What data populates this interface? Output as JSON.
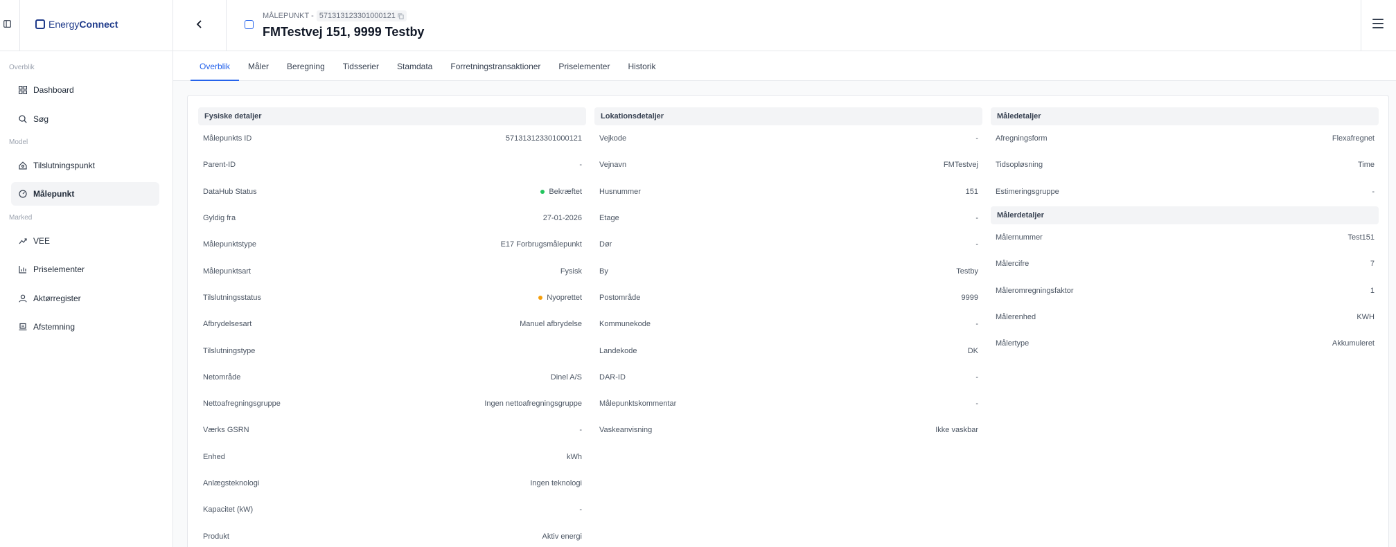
{
  "brand": {
    "name_part1": "Energy",
    "name_part2": "Connect"
  },
  "sidebar": {
    "sections": [
      {
        "label": "Overblik",
        "items": [
          {
            "label": "Dashboard",
            "icon": "grid-icon"
          },
          {
            "label": "Søg",
            "icon": "search-icon"
          }
        ]
      },
      {
        "label": "Model",
        "items": [
          {
            "label": "Tilslutningspunkt",
            "icon": "home-icon"
          },
          {
            "label": "Målepunkt",
            "icon": "gauge-icon",
            "active": true
          }
        ]
      },
      {
        "label": "Marked",
        "items": [
          {
            "label": "VEE",
            "icon": "trend-icon"
          },
          {
            "label": "Priselementer",
            "icon": "chart-icon"
          },
          {
            "label": "Aktørregister",
            "icon": "user-icon"
          },
          {
            "label": "Afstemning",
            "icon": "laptop-icon"
          }
        ]
      }
    ]
  },
  "header": {
    "crumb_label": "MÅLEPUNKT -",
    "crumb_id": "571313123301000121",
    "title": "FMTestvej 151, 9999 Testby"
  },
  "tabs": [
    "Overblik",
    "Måler",
    "Beregning",
    "Tidsserier",
    "Stamdata",
    "Forretningstransaktioner",
    "Priselementer",
    "Historik"
  ],
  "active_tab": "Overblik",
  "colors": {
    "accent": "#2563eb",
    "status_green": "#22c55e",
    "status_amber": "#f59e0b"
  },
  "fysiske": {
    "title": "Fysiske detaljer",
    "rows": [
      {
        "k": "Målepunkts ID",
        "v": "571313123301000121"
      },
      {
        "k": "Parent-ID",
        "v": "-"
      },
      {
        "k": "DataHub Status",
        "v": "Bekræftet"
      },
      {
        "k": "Gyldig fra",
        "v": "27-01-2026"
      },
      {
        "k": "Målepunktstype",
        "v": "E17 Forbrugsmålepunkt"
      },
      {
        "k": "Målepunktsart",
        "v": "Fysisk"
      },
      {
        "k": "Tilslutningsstatus",
        "v": "Nyoprettet"
      },
      {
        "k": "Afbrydelsesart",
        "v": "Manuel afbrydelse"
      },
      {
        "k": "Tilslutningstype",
        "v": ""
      },
      {
        "k": "Netområde",
        "v": "Dinel A/S"
      },
      {
        "k": "Nettoafregningsgruppe",
        "v": "Ingen nettoafregningsgruppe"
      },
      {
        "k": "Værks GSRN",
        "v": "-"
      },
      {
        "k": "Enhed",
        "v": "kWh"
      },
      {
        "k": "Anlægsteknologi",
        "v": "Ingen teknologi"
      },
      {
        "k": "Kapacitet (kW)",
        "v": "-"
      },
      {
        "k": "Produkt",
        "v": "Aktiv energi"
      }
    ]
  },
  "lokation": {
    "title": "Lokationsdetaljer",
    "rows": [
      {
        "k": "Vejkode",
        "v": "-"
      },
      {
        "k": "Vejnavn",
        "v": "FMTestvej"
      },
      {
        "k": "Husnummer",
        "v": "151"
      },
      {
        "k": "Etage",
        "v": "-"
      },
      {
        "k": "Dør",
        "v": "-"
      },
      {
        "k": "By",
        "v": "Testby"
      },
      {
        "k": "Postområde",
        "v": "9999"
      },
      {
        "k": "Kommunekode",
        "v": "-"
      },
      {
        "k": "Landekode",
        "v": "DK"
      },
      {
        "k": "DAR-ID",
        "v": "-"
      },
      {
        "k": "Målepunktskommentar",
        "v": "-"
      },
      {
        "k": "Vaskeanvisning",
        "v": "Ikke vaskbar"
      }
    ]
  },
  "maale": {
    "title": "Måledetaljer",
    "rows": [
      {
        "k": "Afregningsform",
        "v": "Flexafregnet"
      },
      {
        "k": "Tidsopløsning",
        "v": "Time"
      },
      {
        "k": "Estimeringsgruppe",
        "v": "-"
      }
    ]
  },
  "maaler": {
    "title": "Målerdetaljer",
    "rows": [
      {
        "k": "Målernummer",
        "v": "Test151"
      },
      {
        "k": "Målercifre",
        "v": "7"
      },
      {
        "k": "Måleromregningsfaktor",
        "v": "1"
      },
      {
        "k": "Målerenhed",
        "v": "KWH"
      },
      {
        "k": "Målertype",
        "v": "Akkumuleret"
      }
    ]
  }
}
